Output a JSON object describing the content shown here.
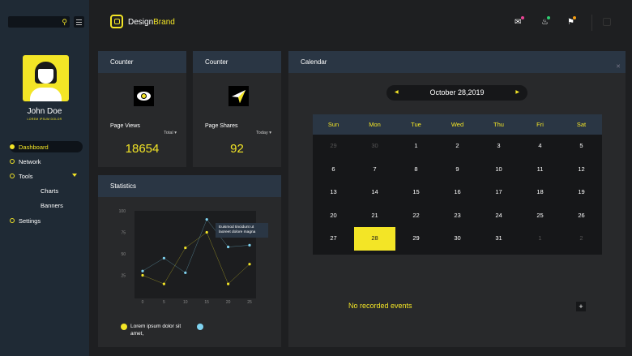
{
  "sidebar": {
    "user": {
      "name": "John Doe",
      "subtitle": "LOREM IPSUM DOLOR"
    },
    "nav": [
      {
        "label": "Dashboard",
        "active": true
      },
      {
        "label": "Network"
      },
      {
        "label": "Tools",
        "expandable": true
      },
      {
        "label": "Charts",
        "sub": true
      },
      {
        "label": "Banners",
        "sub": true
      },
      {
        "label": "Settings"
      }
    ]
  },
  "topbar": {
    "brand_a": "Design",
    "brand_b": "Brand",
    "icons": [
      "mail-icon",
      "bell-icon",
      "flag-icon"
    ],
    "badge_colors": [
      "#e84393",
      "#2ecc71",
      "#f39c12"
    ]
  },
  "counters": [
    {
      "title": "Counter",
      "label": "Page Views",
      "filter": "Total",
      "value": "18654",
      "icon": "eye-icon"
    },
    {
      "title": "Counter",
      "label": "Page Shares",
      "filter": "Today",
      "value": "92",
      "icon": "paper-plane-icon"
    }
  ],
  "statistics": {
    "title": "Statistics",
    "tooltip": [
      "Euismod tincidunt ut",
      "laoreet dolore magna"
    ],
    "legend": [
      {
        "label": "Lorem ipsum dolor sit amet,",
        "color": "#f3e526"
      },
      {
        "label": "",
        "color": "#7fd3f0"
      }
    ]
  },
  "chart_data": {
    "type": "scatter",
    "title": "",
    "xlabel": "",
    "ylabel": "",
    "x_ticks": [
      0,
      5,
      10,
      15,
      20,
      25
    ],
    "y_ticks": [
      25,
      50,
      75,
      100
    ],
    "xlim": [
      0,
      25
    ],
    "ylim": [
      0,
      100
    ],
    "series": [
      {
        "name": "Lorem ipsum dolor sit amet,",
        "color": "#f3e526",
        "x": [
          0,
          5,
          10,
          15,
          20,
          25
        ],
        "y": [
          25,
          15,
          57,
          75,
          15,
          38
        ]
      },
      {
        "name": "",
        "color": "#7fd3f0",
        "x": [
          0,
          5,
          10,
          15,
          20,
          25
        ],
        "y": [
          30,
          45,
          28,
          90,
          58,
          60
        ]
      }
    ]
  },
  "calendar": {
    "title": "Calendar",
    "date_label": "October 28,2019",
    "days": [
      "Sun",
      "Mon",
      "Tue",
      "Wed",
      "Thu",
      "Fri",
      "Sat"
    ],
    "weeks": [
      [
        {
          "d": "29",
          "m": 1
        },
        {
          "d": "30",
          "m": 1
        },
        {
          "d": "1"
        },
        {
          "d": "2"
        },
        {
          "d": "3"
        },
        {
          "d": "4"
        },
        {
          "d": "5"
        }
      ],
      [
        {
          "d": "6"
        },
        {
          "d": "7"
        },
        {
          "d": "8"
        },
        {
          "d": "9"
        },
        {
          "d": "10"
        },
        {
          "d": "11"
        },
        {
          "d": "12"
        }
      ],
      [
        {
          "d": "13"
        },
        {
          "d": "14"
        },
        {
          "d": "15"
        },
        {
          "d": "16"
        },
        {
          "d": "17"
        },
        {
          "d": "18"
        },
        {
          "d": "19"
        }
      ],
      [
        {
          "d": "20"
        },
        {
          "d": "21"
        },
        {
          "d": "22"
        },
        {
          "d": "23"
        },
        {
          "d": "24"
        },
        {
          "d": "25"
        },
        {
          "d": "26"
        }
      ],
      [
        {
          "d": "27"
        },
        {
          "d": "28",
          "s": 1
        },
        {
          "d": "29"
        },
        {
          "d": "30"
        },
        {
          "d": "31"
        },
        {
          "d": "1",
          "m": 1
        },
        {
          "d": "2",
          "m": 1
        }
      ]
    ],
    "no_events": "No recorded events",
    "add_label": "+"
  }
}
